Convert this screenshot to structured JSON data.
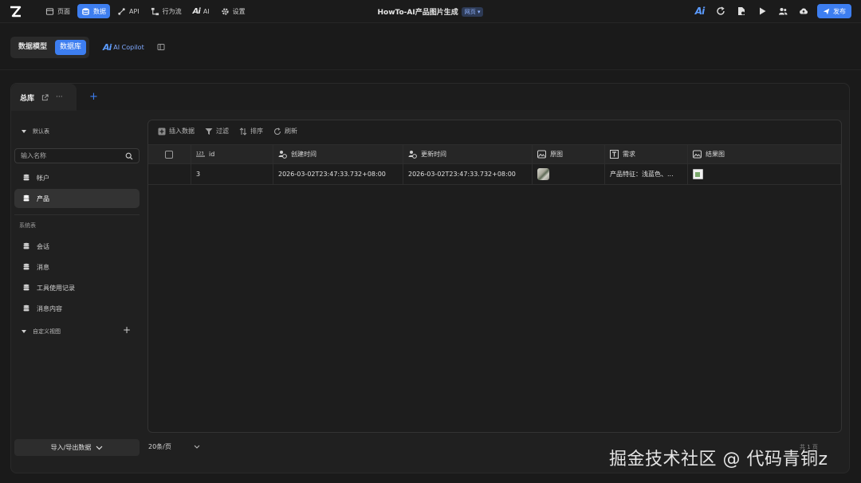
{
  "nav": {
    "items": [
      {
        "label": "页面",
        "icon": "page-icon",
        "active": false
      },
      {
        "label": "数据",
        "icon": "database-icon",
        "active": true
      },
      {
        "label": "API",
        "icon": "api-icon",
        "active": false
      },
      {
        "label": "行为流",
        "icon": "flow-icon",
        "active": false
      },
      {
        "label": "AI",
        "icon": "ai-icon",
        "active": false
      },
      {
        "label": "设置",
        "icon": "gear-icon",
        "active": false
      }
    ]
  },
  "header": {
    "title": "HowTo-AI产品图片生成",
    "tag": "网页",
    "publish_label": "发布",
    "accent": "#3d7ef0"
  },
  "subbar": {
    "seg_model": "数据模型",
    "seg_db": "数据库",
    "copilot": "AI Copilot"
  },
  "tabs": {
    "active": "总库",
    "more": "···",
    "add": "+"
  },
  "sidebar": {
    "default_group": "默认表",
    "search_placeholder": "输入名称",
    "default_items": [
      {
        "label": "帐户",
        "active": false
      },
      {
        "label": "产品",
        "active": true
      }
    ],
    "system_group": "系统表",
    "system_items": [
      {
        "label": "会话"
      },
      {
        "label": "消息"
      },
      {
        "label": "工具使用记录"
      },
      {
        "label": "消息内容"
      }
    ],
    "custom_group": "自定义视图",
    "export_label": "导入/导出数据"
  },
  "toolbar": {
    "insert": "插入数据",
    "filter": "过滤",
    "sort": "排序",
    "refresh": "刷新"
  },
  "table": {
    "columns": [
      {
        "label": "id",
        "icon": "number-icon"
      },
      {
        "label": "创建时间",
        "icon": "clock-user-icon"
      },
      {
        "label": "更新时间",
        "icon": "clock-user-icon"
      },
      {
        "label": "原图",
        "icon": "image-icon"
      },
      {
        "label": "需求",
        "icon": "text-icon"
      },
      {
        "label": "结果图",
        "icon": "image-icon"
      }
    ],
    "rows": [
      {
        "id": "3",
        "created": "2026-03-02T23:47:33.732+08:00",
        "updated": "2026-03-02T23:47:33.732+08:00",
        "requirement": "产品特征：浅蓝色、..."
      }
    ]
  },
  "pagination": {
    "page_size": "20条/页",
    "info": "共 1 页"
  },
  "watermark": "掘金技术社区 @ 代码青铜z"
}
